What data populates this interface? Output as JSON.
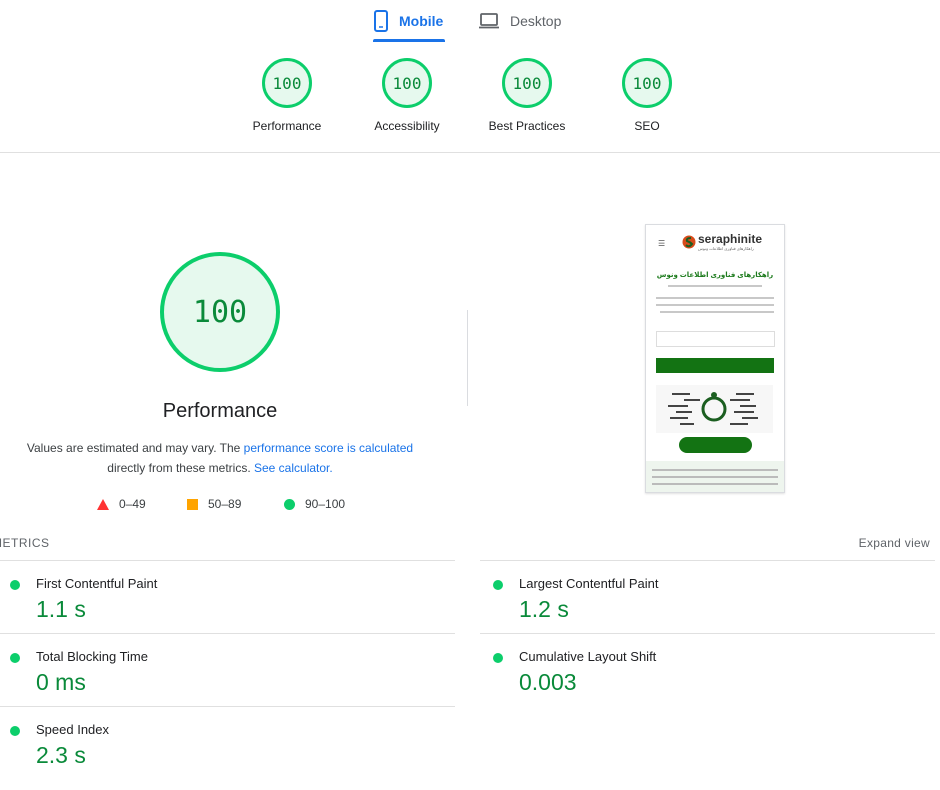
{
  "tabs": {
    "mobile": "Mobile",
    "desktop": "Desktop"
  },
  "scores": [
    {
      "value": "100",
      "label": "Performance"
    },
    {
      "value": "100",
      "label": "Accessibility"
    },
    {
      "value": "100",
      "label": "Best Practices"
    },
    {
      "value": "100",
      "label": "SEO"
    }
  ],
  "main": {
    "score": "100",
    "title": "Performance",
    "desc_prefix": "Values are estimated and may vary. The ",
    "desc_link1": "performance score is calculated",
    "desc_mid": "directly from these metrics.",
    "desc_link2": "See calculator."
  },
  "legend": {
    "fail": "0–49",
    "average": "50–89",
    "pass": "90–100"
  },
  "thumbnail": {
    "brand": "seraphinite",
    "brand_sub": "راهکارهای فناوری اطلاعات ونوس",
    "heading": "راهکارهای فناوری اطلاعات ونوس"
  },
  "metrics": {
    "header": "METRICS",
    "expand": "Expand view",
    "items": [
      {
        "label": "First Contentful Paint",
        "value": "1.1 s"
      },
      {
        "label": "Largest Contentful Paint",
        "value": "1.2 s"
      },
      {
        "label": "Total Blocking Time",
        "value": "0 ms"
      },
      {
        "label": "Cumulative Layout Shift",
        "value": "0.003"
      },
      {
        "label": "Speed Index",
        "value": "2.3 s"
      }
    ]
  },
  "colors": {
    "pass": "#0cce6b",
    "average": "#ffa400",
    "fail": "#ff3333",
    "accent": "#1a73e8"
  }
}
